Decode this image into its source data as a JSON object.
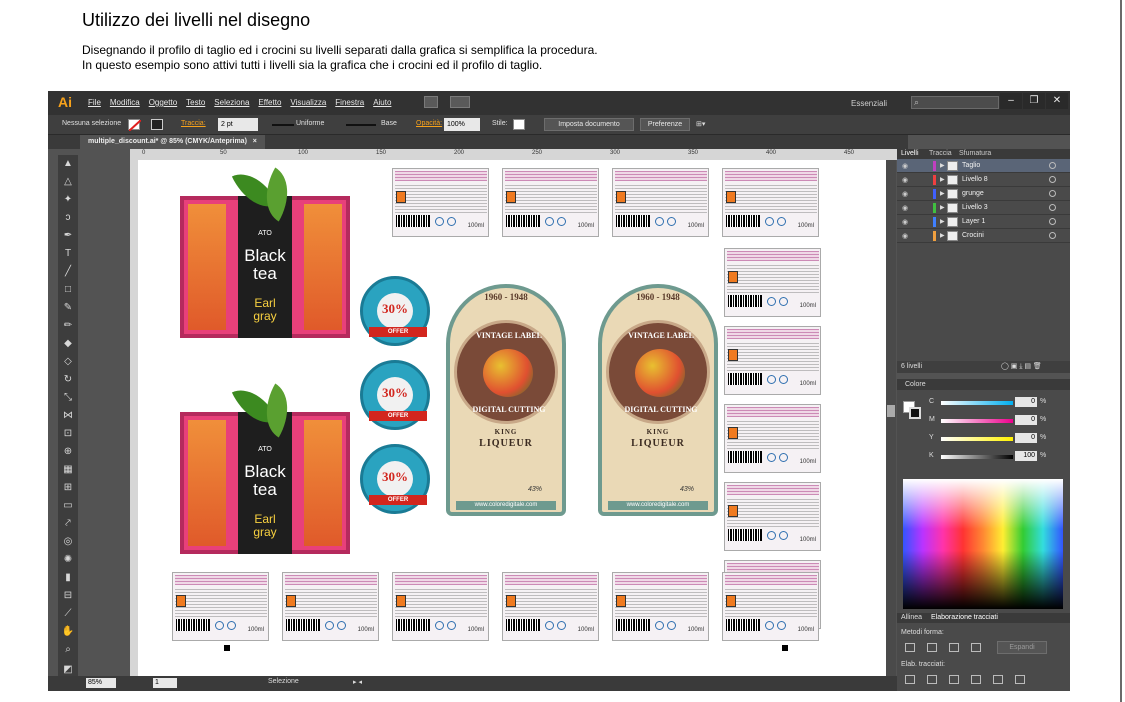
{
  "document": {
    "title": "Utilizzo dei livelli nel disegno",
    "line1": "Disegnando il profilo di taglio ed i crocini su livelli separati dalla grafica si semplifica la procedura.",
    "line2": "In questo esempio sono attivi tutti i livelli sia la grafica che i crocini ed il profilo di taglio."
  },
  "app": {
    "logo": "Ai",
    "menu": [
      "File",
      "Modifica",
      "Oggetto",
      "Testo",
      "Seleziona",
      "Effetto",
      "Visualizza",
      "Finestra",
      "Aiuto"
    ],
    "workspace": "Essenziali",
    "window_buttons": [
      "–",
      "❐",
      "✕"
    ]
  },
  "controlbar": {
    "selection": "Nessuna selezione",
    "stroke_label": "Traccia:",
    "stroke_value": "2 pt",
    "profile": "Uniforme",
    "brush": "Base",
    "opacity_label": "Opacità:",
    "opacity_value": "100%",
    "style_label": "Stile:",
    "doc_setup": "Imposta documento",
    "preferences": "Preferenze"
  },
  "tab": {
    "label": "multiple_discount.ai* @ 85% (CMYK/Anteprima)",
    "close": "×"
  },
  "ruler": {
    "ticks": [
      "0",
      "50",
      "100",
      "150",
      "200",
      "250",
      "300",
      "350",
      "400",
      "450"
    ]
  },
  "labels": {
    "tea": {
      "line1": "Black",
      "line2": "tea",
      "line3": "Earl",
      "line4": "gray",
      "brand": "ATO"
    },
    "badge": {
      "pct": "30%",
      "ribbon": "OFFER"
    },
    "vintage": {
      "top": "1960 - 1948",
      "ring1": "VINTAGE LABEL",
      "ring2": "DIGITAL CUTTING",
      "king": "KING",
      "liqueur": "LIQUEUR",
      "alcohol": "43%",
      "web": "www.coloredigitale.com"
    },
    "mini_ml": "100ml"
  },
  "statusbar": {
    "zoom": "85%",
    "page": "1",
    "tool": "Selezione"
  },
  "panels": {
    "tabs": [
      "Livelli",
      "Traccia",
      "Sfumatura"
    ],
    "layers": [
      {
        "name": "Taglio",
        "color": "#c040c0"
      },
      {
        "name": "Livello 8",
        "color": "#f04040"
      },
      {
        "name": "grunge",
        "color": "#4060ff"
      },
      {
        "name": "Livello 3",
        "color": "#40c040"
      },
      {
        "name": "Layer 1",
        "color": "#4080ff"
      },
      {
        "name": "Crocini",
        "color": "#f0a040"
      }
    ],
    "layer_count": "6 livelli",
    "color": {
      "title": "Colore",
      "rows": [
        {
          "letter": "C",
          "value": "0"
        },
        {
          "letter": "M",
          "value": "0"
        },
        {
          "letter": "Y",
          "value": "0"
        },
        {
          "letter": "K",
          "value": "100"
        }
      ],
      "pct": "%"
    },
    "align": {
      "tabs": [
        "Allinea",
        "Elaborazione tracciati"
      ],
      "shape_modes": "Metodi forma:",
      "expand": "Espandi",
      "pathfinder": "Elab. tracciati:"
    }
  }
}
